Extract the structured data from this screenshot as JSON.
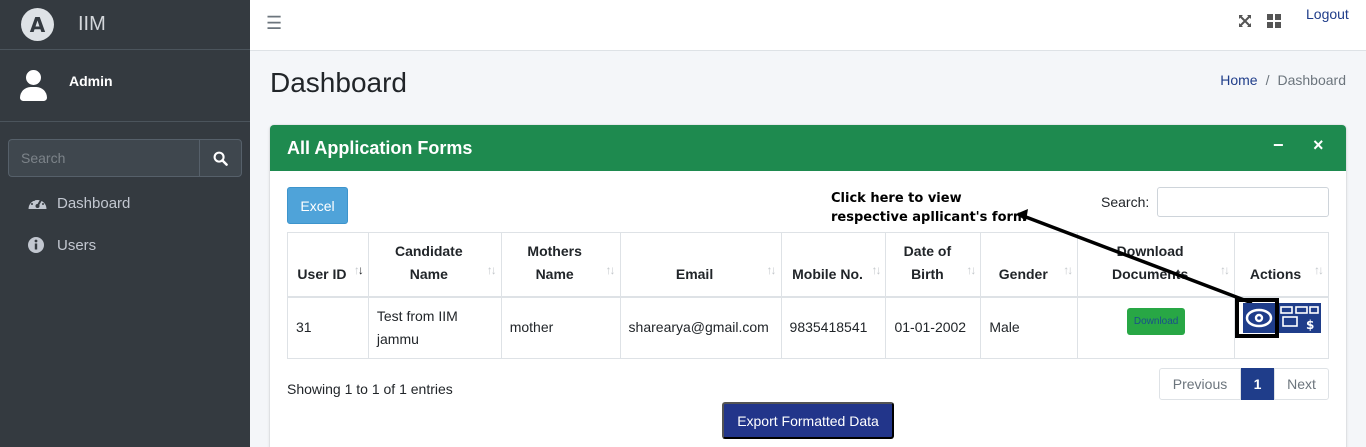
{
  "brand": {
    "logo_letter": "A",
    "name": "IIM"
  },
  "user": {
    "name": "Admin"
  },
  "sidebar": {
    "search_placeholder": "Search",
    "items": [
      {
        "label": "Dashboard",
        "icon": "tachometer-icon"
      },
      {
        "label": "Users",
        "icon": "info-circle-icon"
      }
    ]
  },
  "topbar": {
    "menu_icon": "☰",
    "logout": "Logout"
  },
  "page": {
    "title": "Dashboard",
    "breadcrumb": {
      "home": "Home",
      "separator": "/",
      "current": "Dashboard"
    }
  },
  "card": {
    "title": "All Application Forms",
    "minimize": "−",
    "close": "×",
    "excel_label": "Excel",
    "search_label": "Search:",
    "annotation_line1": "Click here to view",
    "annotation_line2": "respective apllicant's form",
    "columns": [
      "User ID",
      "Candidate Name",
      "Mothers Name",
      "Email",
      "Mobile No.",
      "Date of Birth",
      "Gender",
      "Download Documents",
      "Actions"
    ],
    "rows": [
      {
        "user_id": "31",
        "candidate_name": "Test from IIM jammu",
        "mothers_name": "mother",
        "email": "sharearya@gmail.com",
        "mobile": "9835418541",
        "dob": "01-01-2002",
        "gender": "Male",
        "download_label": "Download"
      }
    ],
    "showing": "Showing 1 to 1 of 1 entries",
    "pagination": {
      "previous": "Previous",
      "current": "1",
      "next": "Next"
    },
    "export_label": "Export Formatted Data"
  },
  "colors": {
    "sidebar": "#343a40",
    "header_green": "#1e8a4f",
    "primary": "#22358a",
    "excel": "#4fa3d9",
    "badge": "#28a745"
  }
}
